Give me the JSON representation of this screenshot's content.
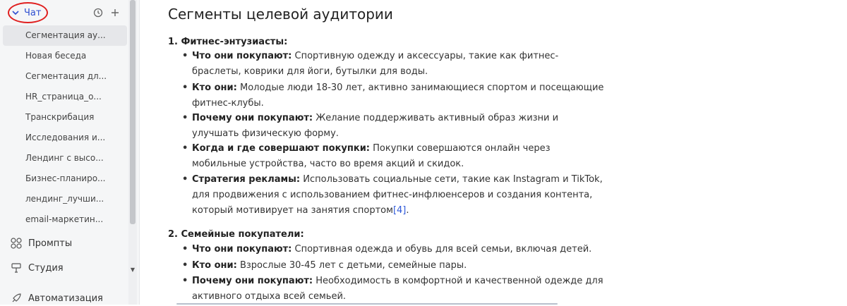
{
  "sidebar": {
    "chat_label": "Чат",
    "chats": [
      "Сегментация ау...",
      "Новая беседа",
      "Сегментация дл...",
      "HR_страница_о...",
      "Транскрибация",
      "Исследования и...",
      "Лендинг с высо...",
      "Бизнес-планиро...",
      "лендинг_лучши...",
      "email-маркетин..."
    ],
    "nav": {
      "prompts": "Промпты",
      "studio": "Студия",
      "automation": "Автоматизация"
    }
  },
  "content": {
    "title": "Сегменты целевой аудитории",
    "sections": [
      {
        "heading": "1. Фитнес-энтузиасты:",
        "items": [
          {
            "label": "Что они покупают:",
            "text": " Спортивную одежду и аксессуары, такие как фитнес-браслеты, коврики для йоги, бутылки для воды."
          },
          {
            "label": "Кто они:",
            "text": " Молодые люди 18-30 лет, активно занимающиеся спортом и посещающие фитнес-клубы."
          },
          {
            "label": "Почему они покупают:",
            "text": " Желание поддерживать активный образ жизни и улучшать физическую форму."
          },
          {
            "label": "Когда и где совершают покупки:",
            "text": " Покупки совершаются онлайн через мобильные устройства, часто во время акций и скидок."
          },
          {
            "label": "Стратегия рекламы:",
            "text": " Использовать социальные сети, такие как Instagram и TikTok, для продвижения с использованием фитнес-инфлюенсеров и создания контента, который мотивирует на занятия спортом",
            "ref": "[4]",
            "tail": "."
          }
        ]
      },
      {
        "heading": "2. Семейные покупатели:",
        "items": [
          {
            "label": "Что они покупают:",
            "text": " Спортивная одежда и обувь для всей семьи, включая детей."
          },
          {
            "label": "Кто они:",
            "text": " Взрослые 30-45 лет с детьми, семейные пары."
          },
          {
            "label": "Почему они покупают:",
            "text": " Необходимость в комфортной и качественной одежде для активного отдыха всей семьей."
          }
        ]
      }
    ]
  },
  "colors": {
    "accent": "#2f4fd0",
    "highlight_circle": "#e02020"
  }
}
